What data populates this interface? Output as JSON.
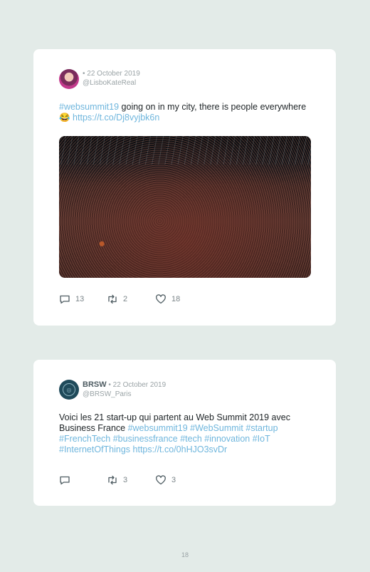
{
  "tweets": [
    {
      "date": "• 22 October 2019",
      "handle": "@LisboKateReal",
      "text_parts": [
        "#websummit19",
        " going on in my city, there is people everywhere 😂 ",
        "https://t.co/Dj8vyjbk6n"
      ],
      "replies": "13",
      "retweets": "2",
      "likes": "18"
    },
    {
      "name": "BRSW",
      "date": " • 22 October 2019",
      "handle": "@BRSW_Paris",
      "text_plain": "Voici les 21 start-up qui partent au Web Summit 2019 avec Business France ",
      "text_tags": "#websummit19 #WebSummit #startup #FrenchTech #businessfrance #tech #innovation #IoT #InternetOfThings https://t.co/0hHJO3svDr",
      "replies": "",
      "retweets": "3",
      "likes": "3"
    }
  ],
  "page_number": "18",
  "colors": {
    "background": "#e3ebe8",
    "link": "#6fb6dd",
    "meta": "#9aa3a6"
  },
  "icons": [
    "reply-icon",
    "retweet-icon",
    "like-icon"
  ]
}
